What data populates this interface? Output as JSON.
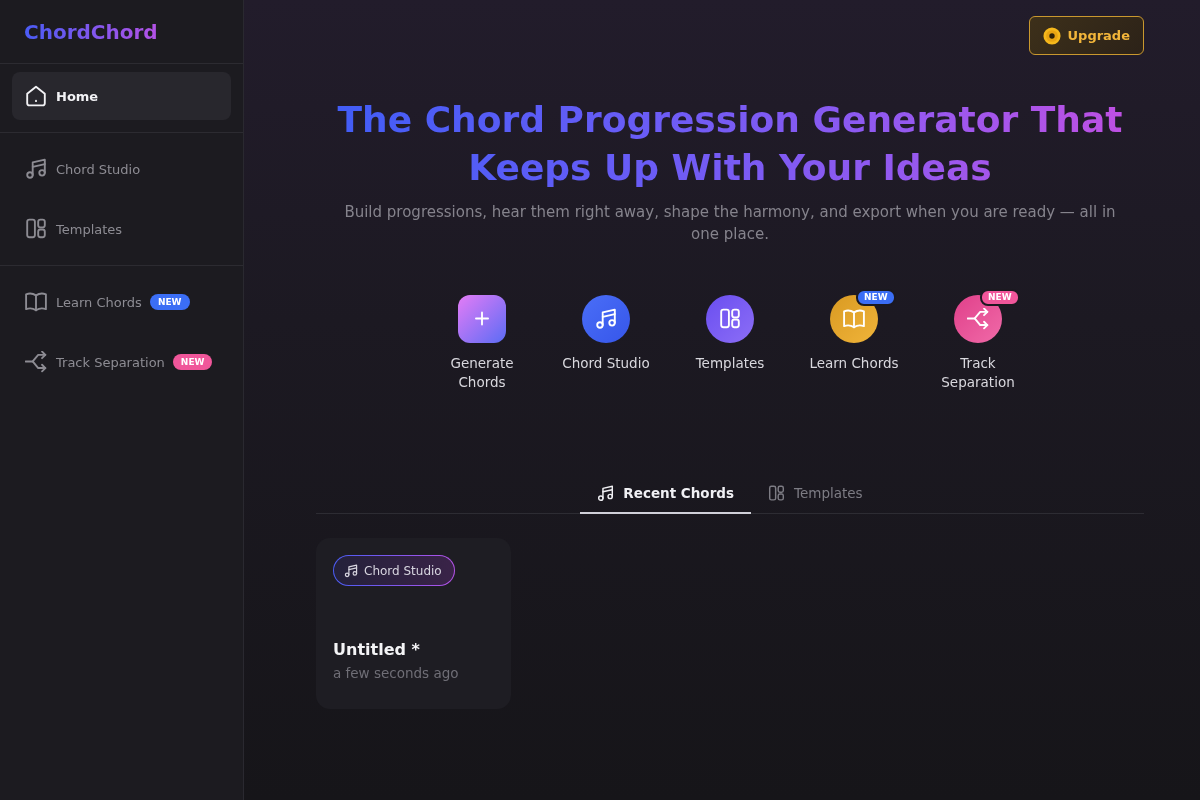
{
  "sidebar": {
    "logo": "ChordChord",
    "groups": [
      {
        "items": [
          {
            "kind": "home",
            "label": "Home",
            "selected": true
          }
        ]
      },
      {
        "items": [
          {
            "kind": "studio",
            "label": "Chord Studio",
            "selected": false
          },
          {
            "kind": "templates",
            "label": "Templates",
            "selected": false
          }
        ]
      },
      {
        "items": [
          {
            "kind": "learn",
            "label": "Learn Chords",
            "selected": false,
            "badge": {
              "text": "NEW",
              "color": "#3b6ef5"
            }
          },
          {
            "kind": "separation",
            "label": "Track Separation",
            "selected": false,
            "badge": {
              "text": "NEW",
              "color": "#f0569a"
            }
          }
        ]
      }
    ]
  },
  "upgrade_button": {
    "label": "Upgrade"
  },
  "hero": {
    "title": "The Chord Progression Generator That Keeps Up With Your Ideas",
    "subtitle": "Build progressions, hear them right away, shape the harmony, and export when you are ready — all in one place."
  },
  "shortcuts": [
    {
      "kind": "generate",
      "label": "Generate Chords"
    },
    {
      "kind": "studio",
      "label": "Chord Studio"
    },
    {
      "kind": "templates",
      "label": "Templates"
    },
    {
      "kind": "learn",
      "label": "Learn Chords",
      "badge": {
        "text": "NEW",
        "color": "#3b6ef5"
      }
    },
    {
      "kind": "separation",
      "label": "Track Separation",
      "badge": {
        "text": "NEW",
        "color": "#f0569a"
      }
    }
  ],
  "tabs": [
    {
      "kind": "studio",
      "label": "Recent Chords",
      "selected": true
    },
    {
      "kind": "templates",
      "label": "Templates",
      "selected": false
    }
  ],
  "cards": [
    {
      "tag": "Chord Studio",
      "title": "Untitled *",
      "time": "a few seconds ago"
    }
  ]
}
